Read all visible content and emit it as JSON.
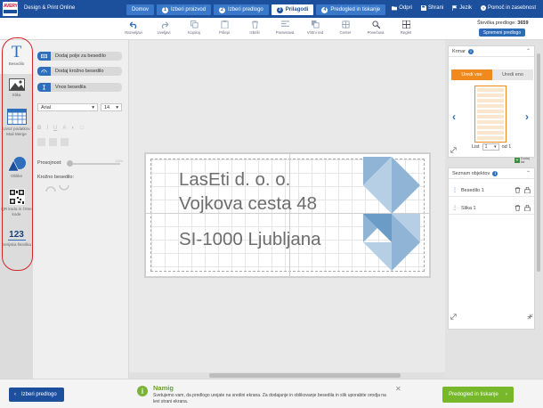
{
  "header": {
    "logo_top": "AVERY",
    "logo_bottom": "Zweckform",
    "app_title": "Design & Print Online",
    "steps": [
      {
        "label": "Domov",
        "num": ""
      },
      {
        "label": "Izberi proizvod",
        "num": "1"
      },
      {
        "label": "Izberi predlogo",
        "num": "2"
      },
      {
        "label": "Prilagodi",
        "num": "3"
      },
      {
        "label": "Predogled in tiskanje",
        "num": "4"
      }
    ],
    "links": [
      "Odpri",
      "Shrani",
      "Jezik",
      "Pomoč in zasebnost"
    ]
  },
  "toolbar": {
    "tools": [
      "Razveljavi",
      "Uveljavi",
      "Kopiraj",
      "Prilepi",
      "Izbriši",
      "Poravnava",
      "Vrstni red",
      "Center",
      "Povečava",
      "Reglet"
    ],
    "counter_label": "Številka predloge:",
    "counter_value": "3659",
    "save_label": "Spremeni predlogo"
  },
  "rail": {
    "items": [
      "Besedilo",
      "Slika",
      "Uvoz podatkov Mail Merge",
      "Oblike",
      "QR koda in črtne kode",
      "Serijska številka"
    ],
    "serial_icon_text": "123",
    "text_icon_glyph": "T"
  },
  "text_panel": {
    "buttons": [
      "Dodaj polje za besedilo",
      "Dodaj krožno besedilo",
      "Vnos besedila"
    ],
    "font_value": "Arial",
    "size_value": "14",
    "transparency_label": "Prosojnost:",
    "transparency_value": "100%",
    "circular_label": "Krožno besedilo:"
  },
  "label": {
    "lines": [
      "LasEti d. o. o.",
      "Vojkova cesta 48",
      "SI-1000 Ljubljana"
    ]
  },
  "frame_card": {
    "title": "Krmar",
    "tabs": [
      "Uredi vse",
      "Uredi eno"
    ],
    "list_label": "List",
    "page_value": "1",
    "of_label": "od 1",
    "add_page_label": "Dodaj list"
  },
  "objects_card": {
    "title": "Seznam objektov",
    "items": [
      "Besedilo 1",
      "Slika 1"
    ]
  },
  "footer": {
    "back_label": "Izberi predlogo",
    "tip_title": "Namig",
    "tip_body": "Svetujemo vam, da predlogo urejate na sredini ekrana. Za dodajanje in oblikovanje besedila in slik uporabite orodja na levi strani ekrana.",
    "next_label": "Predogled in tiskanje"
  },
  "colors": {
    "brand_blue": "#1c4f9c",
    "accent_orange": "#f08a1c",
    "cta_green": "#76b82a",
    "highlight_red": "#d0262a",
    "art_blue": "#8fb4d6"
  }
}
